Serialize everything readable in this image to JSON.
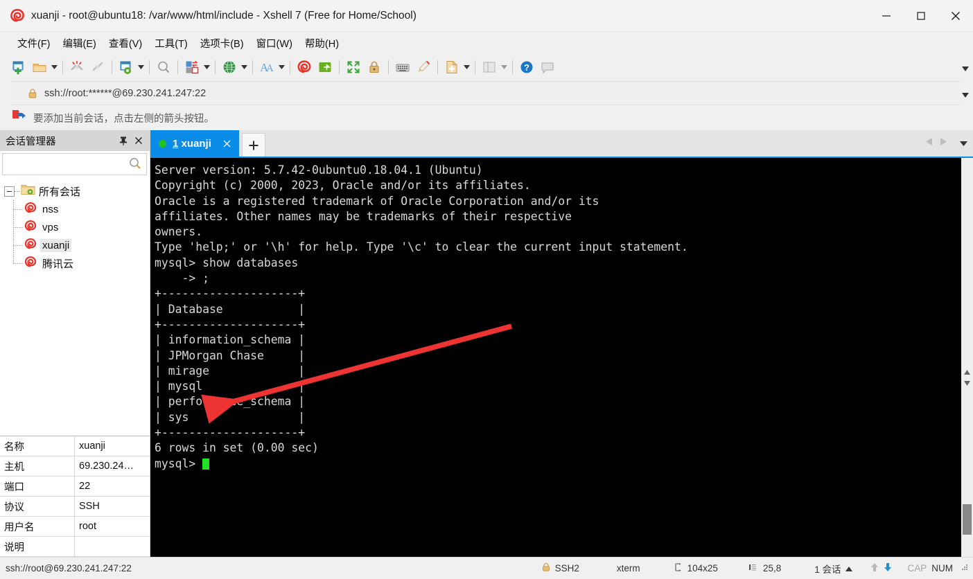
{
  "window": {
    "title": "xuanji - root@ubuntu18: /var/www/html/include - Xshell 7 (Free for Home/School)",
    "app_icon": "xshell-spiral-icon",
    "minimize_label": "—",
    "maximize_label": "□",
    "close_label": "✕"
  },
  "menu": {
    "items": [
      {
        "label": "文件(F)",
        "name": "menu-file"
      },
      {
        "label": "编辑(E)",
        "name": "menu-edit"
      },
      {
        "label": "查看(V)",
        "name": "menu-view"
      },
      {
        "label": "工具(T)",
        "name": "menu-tools"
      },
      {
        "label": "选项卡(B)",
        "name": "menu-tabs"
      },
      {
        "label": "窗口(W)",
        "name": "menu-window"
      },
      {
        "label": "帮助(H)",
        "name": "menu-help"
      }
    ]
  },
  "toolbar": {
    "icons": [
      "new-session-icon",
      "open-folder-icon",
      "disconnect-icon",
      "reconnect-icon",
      "session-properties-icon",
      "find-icon",
      "transfer-file-icon",
      "globe-icon",
      "font-icon",
      "xshell-icon",
      "xftp-icon",
      "fullscreen-icon",
      "lock-icon",
      "keyboard-icon",
      "highlight-icon",
      "new-file-icon",
      "layout-icon",
      "help-icon",
      "comment-icon"
    ],
    "overflow_label": "▾"
  },
  "address_bar": {
    "lock_icon": "lock-icon",
    "url": "ssh://root:******@69.230.241.247:22",
    "dropdown_icon": "chevron-down-icon"
  },
  "notification": {
    "icon": "red-flag-arrow-icon",
    "text": "要添加当前会话，点击左侧的箭头按钮。"
  },
  "sidebar": {
    "title": "会话管理器",
    "pin_icon": "pin-icon",
    "close_icon": "close-icon",
    "search": {
      "value": "",
      "placeholder": "",
      "icon": "search-icon"
    },
    "tree": {
      "root": {
        "label": "所有会话",
        "icon": "folder-sessions-icon",
        "expanded": true
      },
      "items": [
        {
          "label": "nss",
          "icon": "xshell-session-icon",
          "selected": false
        },
        {
          "label": "vps",
          "icon": "xshell-session-icon",
          "selected": false
        },
        {
          "label": "xuanji",
          "icon": "xshell-session-icon",
          "selected": true
        },
        {
          "label": "腾讯云",
          "icon": "xshell-session-icon",
          "selected": false
        }
      ]
    },
    "properties": [
      {
        "key": "名称",
        "value": "xuanji"
      },
      {
        "key": "主机",
        "value": "69.230.24…"
      },
      {
        "key": "端口",
        "value": "22"
      },
      {
        "key": "协议",
        "value": "SSH"
      },
      {
        "key": "用户名",
        "value": "root"
      },
      {
        "key": "说明",
        "value": ""
      }
    ]
  },
  "tabs": {
    "items": [
      {
        "index": "1",
        "label": "xuanji",
        "active": true,
        "status_dot": "#21c221",
        "close_icon": "close-icon"
      }
    ],
    "new_tab_label": "+",
    "prev_icon": "chevron-left-icon",
    "next_icon": "chevron-right-icon",
    "list_icon": "chevron-down-icon"
  },
  "terminal": {
    "lines": [
      "Server version: 5.7.42-0ubuntu0.18.04.1 (Ubuntu)",
      "",
      "Copyright (c) 2000, 2023, Oracle and/or its affiliates.",
      "",
      "Oracle is a registered trademark of Oracle Corporation and/or its",
      "affiliates. Other names may be trademarks of their respective",
      "owners.",
      "",
      "Type 'help;' or '\\h' for help. Type '\\c' to clear the current input statement.",
      "",
      "mysql> show databases",
      "    -> ;",
      "+--------------------+",
      "| Database           |",
      "+--------------------+",
      "| information_schema |",
      "| JPMorgan Chase     |",
      "| mirage             |",
      "| mysql              |",
      "| performance_schema |",
      "| sys                |",
      "+--------------------+",
      "6 rows in set (0.00 sec)",
      ""
    ],
    "prompt": "mysql> ",
    "cursor": "block-cursor",
    "annotation": {
      "type": "arrow",
      "color": "#ee3333",
      "points_at": "JPMorgan Chase"
    }
  },
  "statusbar": {
    "connection": "ssh://root@69.230.241.247:22",
    "security_icon": "lock-icon",
    "protocol": "SSH2",
    "term_type": "xterm",
    "size_icon": "resize-icon",
    "size": "104x25",
    "cursor_icon": "cursor-pos-icon",
    "cursor_pos": "25,8",
    "sessions": "1 会话",
    "sessions_caret": "▴",
    "up_icon": "arrow-up-icon",
    "down_icon": "arrow-down-icon",
    "cap": "CAP",
    "num": "NUM"
  }
}
